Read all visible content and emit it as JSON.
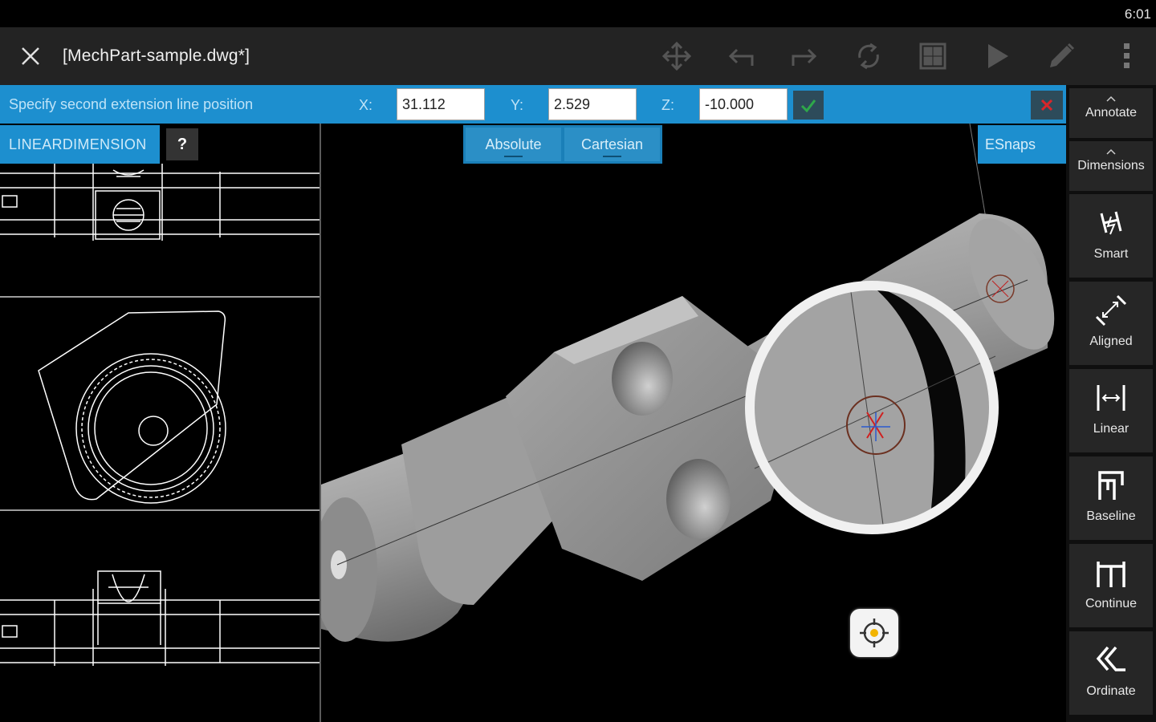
{
  "status_bar": {
    "time": "6:01"
  },
  "toolbar": {
    "title": "[MechPart-sample.dwg*]",
    "icons": [
      "close-icon",
      "move-icon",
      "undo-icon",
      "redo-icon",
      "regen-icon",
      "layout-grid-icon",
      "play-icon",
      "pencil-icon",
      "more-vertical-icon"
    ]
  },
  "prompt": {
    "text": "Specify second extension line position",
    "x_label": "X:",
    "x_value": "31.112",
    "y_label": "Y:",
    "y_value": "2.529",
    "z_label": "Z:",
    "z_value": "-10.000"
  },
  "command": {
    "name": "LINEARDIMENSION",
    "help": "?"
  },
  "modes": {
    "absolute": "Absolute",
    "cartesian": "Cartesian"
  },
  "esnaps": "ESnaps",
  "ribbon": {
    "categories": [
      {
        "label": "Annotate"
      },
      {
        "label": "Dimensions"
      }
    ],
    "tools": [
      {
        "label": "Smart",
        "icon": "smart-dimension-icon"
      },
      {
        "label": "Aligned",
        "icon": "aligned-dimension-icon"
      },
      {
        "label": "Linear",
        "icon": "linear-dimension-icon"
      },
      {
        "label": "Baseline",
        "icon": "baseline-dimension-icon"
      },
      {
        "label": "Continue",
        "icon": "continue-dimension-icon"
      },
      {
        "label": "Ordinate",
        "icon": "ordinate-dimension-icon"
      }
    ]
  },
  "colors": {
    "accent": "#1d8fcf",
    "toolbar": "#232323",
    "ribbon_button": "#262626",
    "confirm": "#2ea84a",
    "cancel": "#d8262a"
  }
}
